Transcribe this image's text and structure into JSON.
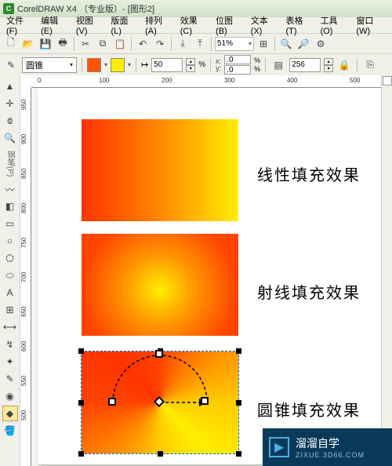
{
  "app": {
    "title": "CorelDRAW X4 （专业版）- [图形2]",
    "icon": "C"
  },
  "menu": {
    "file": "文件(F)",
    "edit": "编辑(E)",
    "view": "视图(V)",
    "layout": "版面(L)",
    "arrange": "排列(A)",
    "effects": "效果(C)",
    "bitmap": "位图(B)",
    "text": "文本(X)",
    "table": "表格(T)",
    "tools": "工具(O)",
    "window": "窗口(W)"
  },
  "toolbar": {
    "zoom": "51%"
  },
  "propbar": {
    "filltype": "圆锥",
    "color1": "#ff5500",
    "color2": "#ffee00",
    "midpoint": "50",
    "edge_x": ".0",
    "edge_y": ".0",
    "copies": "256"
  },
  "ruler": {
    "h": [
      "0",
      "100",
      "200",
      "300",
      "400",
      "500"
    ],
    "v": [
      "950",
      "900",
      "850",
      "800",
      "750",
      "700",
      "650",
      "600",
      "550",
      "500"
    ]
  },
  "labels": {
    "linear": "线性填充效果",
    "radial": "射线填充效果",
    "conical": "圆锥填充效果"
  },
  "toolbox_label": "钢笔(P)",
  "watermark": {
    "brand": "溜溜自学",
    "sub": "ZIXUE.3D66.COM"
  }
}
